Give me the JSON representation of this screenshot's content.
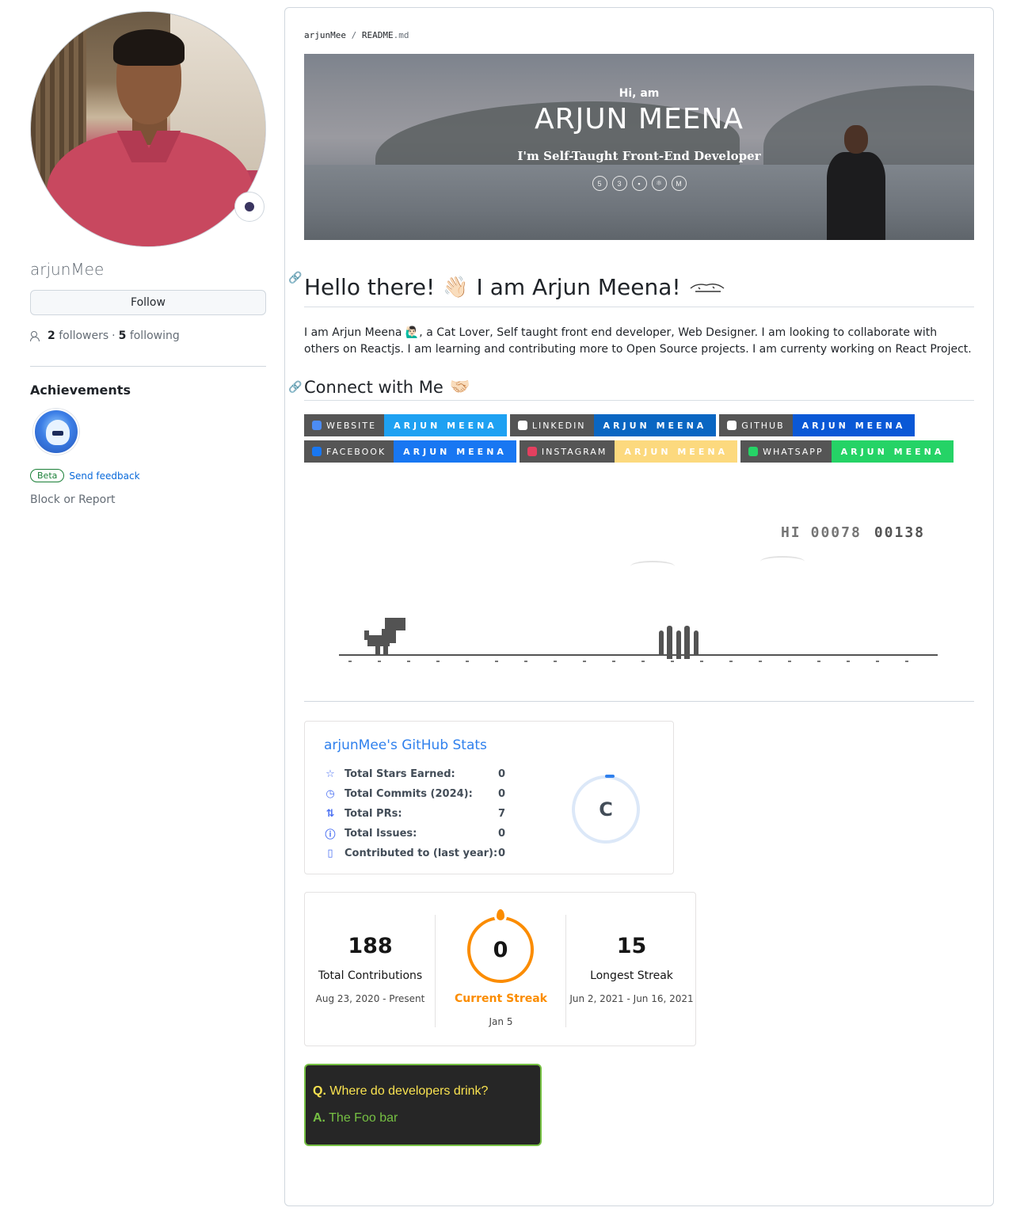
{
  "profile": {
    "username": "arjunMee",
    "follow_label": "Follow",
    "followers_count": "2",
    "followers_label": "followers",
    "separator": "·",
    "following_count": "5",
    "following_label": "following",
    "achievements_title": "Achievements",
    "beta_label": "Beta",
    "feedback_label": "Send feedback",
    "block_label": "Block or Report"
  },
  "readme": {
    "breadcrumb_owner": "arjunMee",
    "breadcrumb_sep": "/",
    "breadcrumb_file": "README",
    "breadcrumb_ext": ".md",
    "banner": {
      "greeting": "Hi, am",
      "name": "ARJUN MEENA",
      "tagline": "I'm Self-Taught Front-End Developer"
    },
    "heading": "Hello there!",
    "heading_emoji": "👋🏻",
    "heading_part2": "I am Arjun Meena!",
    "bio": "I am Arjun Meena 🙋🏻‍♂️, a Cat Lover, Self taught front end developer, Web Designer. I am looking to collaborate with others on Reactjs. I am learning and contributing more to Open Source projects. I am currenty working on React Project.",
    "connect_heading": "Connect with Me",
    "connect_emoji": "🤝🏻",
    "badges": [
      {
        "label": "WEBSITE",
        "message": "ARJUN MEENA",
        "color": "#1ea1f2",
        "icon_color": "#4c8cf5"
      },
      {
        "label": "LINKEDIN",
        "message": "ARJUN MEENA",
        "color": "#0a66c2",
        "icon_color": "#ffffff"
      },
      {
        "label": "GITHUB",
        "message": "ARJUN MEENA",
        "color": "#0a58d6",
        "icon_color": "#ffffff"
      },
      {
        "label": "FACEBOOK",
        "message": "ARJUN MEENA",
        "color": "#1877f2",
        "icon_color": "#1877f2"
      },
      {
        "label": "INSTAGRAM",
        "message": "ARJUN MEENA",
        "color": "#fcd97e",
        "icon_color": "#e4405f"
      },
      {
        "label": "WHATSAPP",
        "message": "ARJUN MEENA",
        "color": "#25d366",
        "icon_color": "#25d366"
      }
    ],
    "game": {
      "hi_label": "HI",
      "hi_score": "00078",
      "score": "00138"
    },
    "github_stats": {
      "title": "arjunMee's GitHub Stats",
      "rank": "C",
      "rows": [
        {
          "icon": "star-icon",
          "glyph": "☆",
          "label": "Total Stars Earned:",
          "value": "0"
        },
        {
          "icon": "history-icon",
          "glyph": "◷",
          "label": "Total Commits (2024):",
          "value": "0"
        },
        {
          "icon": "pull-request-icon",
          "glyph": "⇅",
          "label": "Total PRs:",
          "value": "7"
        },
        {
          "icon": "issue-icon",
          "glyph": "ⓘ",
          "label": "Total Issues:",
          "value": "0"
        },
        {
          "icon": "repo-icon",
          "glyph": "▯",
          "label": "Contributed to (last year):",
          "value": "0"
        }
      ]
    },
    "streak": {
      "total": "188",
      "total_label": "Total Contributions",
      "total_range": "Aug 23, 2020 - Present",
      "current": "0",
      "current_label": "Current Streak",
      "current_date": "Jan 5",
      "longest": "15",
      "longest_label": "Longest Streak",
      "longest_range": "Jun 2, 2021 - Jun 16, 2021"
    },
    "joke": {
      "q_prefix": "Q.",
      "question": "Where do developers drink?",
      "a_prefix": "A.",
      "answer": "The Foo bar"
    }
  }
}
